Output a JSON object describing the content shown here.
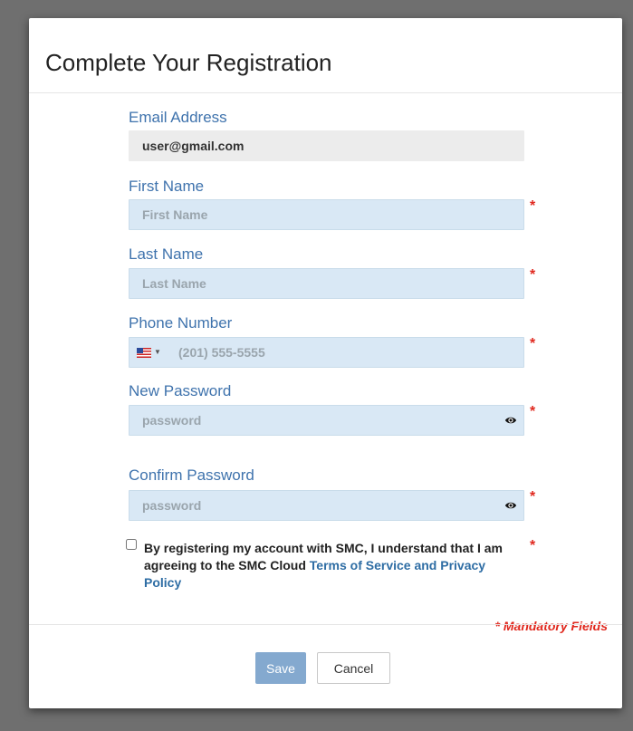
{
  "modal": {
    "title": "Complete Your Registration",
    "mandatory_note": "* Mandatory Fields",
    "required_mark": "*"
  },
  "fields": {
    "email": {
      "label": "Email Address",
      "value": "user@gmail.com"
    },
    "first_name": {
      "label": "First Name",
      "placeholder": "First Name"
    },
    "last_name": {
      "label": "Last Name",
      "placeholder": "Last Name"
    },
    "phone": {
      "label": "Phone Number",
      "placeholder": "(201) 555-5555",
      "country_caret": "▼"
    },
    "new_password": {
      "label": "New Password",
      "placeholder": "password"
    },
    "confirm_password": {
      "label": "Confirm Password",
      "placeholder": "password"
    }
  },
  "terms": {
    "text": "By registering my account with SMC, I understand that I am agreeing to the SMC Cloud ",
    "link": "Terms of Service and Privacy Policy"
  },
  "buttons": {
    "save": "Save",
    "cancel": "Cancel"
  },
  "colors": {
    "label": "#3f73ad",
    "field_bg": "#d9e8f5",
    "required": "#e0281e",
    "save_bg": "#84a9cf"
  },
  "icons": {
    "password_toggle": "eye-icon",
    "country_flag": "us-flag-icon"
  }
}
